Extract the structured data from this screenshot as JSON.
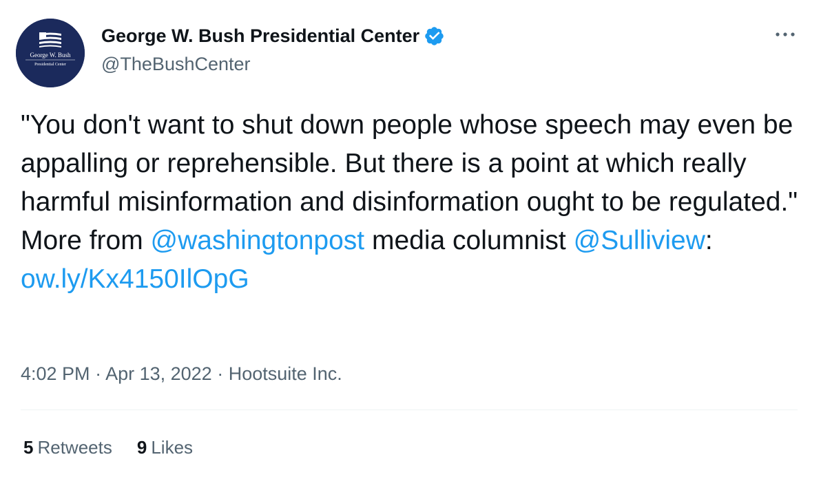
{
  "author": {
    "name": "George W. Bush Presidential Center",
    "handle": "@TheBushCenter",
    "avatar_line1": "George W. Bush",
    "avatar_line2": "Presidential Center",
    "verified_icon": "verified-badge-icon"
  },
  "tweet": {
    "text_part1": "\"You don't want to shut down people whose speech may even be appalling or reprehensible. But there is a point at which really harmful misinformation and disinformation ought to be regulated.\"  More from ",
    "mention1": "@washingtonpost",
    "text_part2": " media columnist ",
    "mention2": "@Sulliview",
    "text_part3": ": ",
    "link": "ow.ly/Kx4150IlOpG"
  },
  "meta": {
    "time": "4:02 PM",
    "sep1": " · ",
    "date": "Apr 13, 2022",
    "sep2": " · ",
    "source": "Hootsuite Inc."
  },
  "stats": {
    "retweets_count": "5",
    "retweets_label": "Retweets",
    "likes_count": "9",
    "likes_label": "Likes"
  },
  "colors": {
    "link": "#1d9bf0",
    "verified": "#1d9bf0",
    "avatar_bg": "#1b2a5c",
    "secondary_text": "#536471"
  }
}
